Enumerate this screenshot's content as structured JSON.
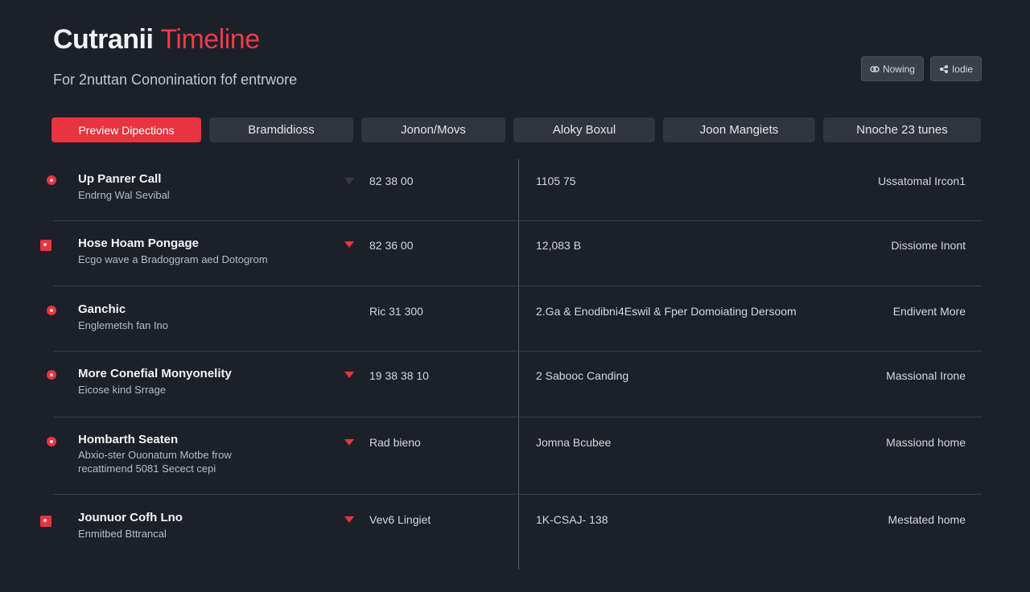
{
  "header": {
    "title_main": "Cutranii ",
    "title_accent": "Timeline",
    "subtitle": "For 2nuttan Cononination fof entrwore"
  },
  "actions": [
    {
      "label": "Nowing",
      "icon": "link-icon"
    },
    {
      "label": "Iodie",
      "icon": "share-icon"
    }
  ],
  "tabs": [
    {
      "label": "Preview Dipections",
      "active": true
    },
    {
      "label": "Bramdidioss",
      "active": false
    },
    {
      "label": "Jonon/Movs",
      "active": false
    },
    {
      "label": "Aloky Boxul",
      "active": false
    },
    {
      "label": "Joon Mangiets",
      "active": false
    },
    {
      "label": "Nnoche 23 tunes",
      "active": false
    }
  ],
  "rows": [
    {
      "title": "Up Panrer Call",
      "desc": [
        "Endrng Wal Sevibal"
      ],
      "col_a": "82 38 00",
      "col_b": "1105 75",
      "col_c": "Ussatomal Ircon1",
      "marker": "dot",
      "caret": "dim"
    },
    {
      "title": "Hose Hoam Pongage",
      "desc": [
        "Ecgo wave a Bradoggram aed Dotogrom"
      ],
      "col_a": "82 36 00",
      "col_b": "12,083 B",
      "col_c": "Dissiome Inont",
      "marker": "square",
      "caret": "red"
    },
    {
      "title": "Ganchic",
      "desc": [
        "Englemetsh fan Ino"
      ],
      "col_a": "Ric 31 300",
      "col_b": "2.Ga & Enodibni4Eswil & Fper Domoiating Dersoom",
      "col_c": "Endivent More",
      "marker": "dot",
      "caret": "none"
    },
    {
      "title": "More Conefial Monyonelity",
      "desc": [
        "Eicose kind Srrage"
      ],
      "col_a": "19 38 38 10",
      "col_b": "2 Sabooc Canding",
      "col_c": "Massional Irone",
      "marker": "dot",
      "caret": "red"
    },
    {
      "title": "Hombarth Seaten",
      "desc": [
        "Abxio-ster Ouonatum Motbe frow",
        "recattimend 5081 Secect cepi"
      ],
      "col_a": "Rad bieno",
      "col_b": "Jomna Bcubee",
      "col_c": "Massiond home",
      "marker": "dot",
      "caret": "red"
    },
    {
      "title": "Jounuor Cofh Lno",
      "desc": [
        "Enmitbed Bttrancal"
      ],
      "col_a": "Vev6 Lingiet",
      "col_b": "1K-CSAJ- 138",
      "col_c": "Mestated home",
      "marker": "square",
      "caret": "red"
    }
  ]
}
